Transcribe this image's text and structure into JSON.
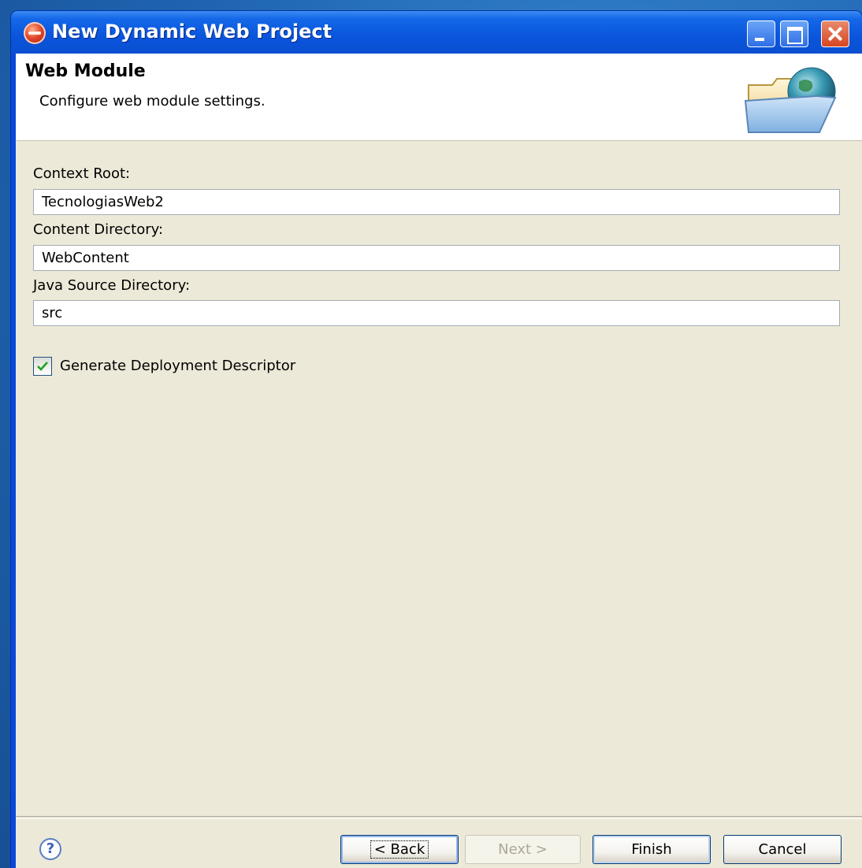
{
  "window": {
    "title": "New Dynamic Web Project"
  },
  "banner": {
    "title": "Web Module",
    "description": "Configure web module settings."
  },
  "fields": [
    {
      "label": "Context Root:",
      "value": "TecnologiasWeb2"
    },
    {
      "label": "Content Directory:",
      "value": "WebContent"
    },
    {
      "label": "Java Source Directory:",
      "value": "src"
    }
  ],
  "options": {
    "generate_dd_label": "Generate Deployment Descriptor",
    "generate_dd_checked": true
  },
  "buttons": {
    "help": "?",
    "back": "< Back",
    "next": "Next >",
    "finish": "Finish",
    "cancel": "Cancel"
  },
  "colors": {
    "titlebar": "#0a55dc",
    "dialog_bg": "#ece9d8",
    "banner_bg": "#ffffff",
    "desktop": "#1f64b0"
  },
  "icons": {
    "app": "eclipse-icon",
    "banner": "folder-globe-icon",
    "help": "help-icon",
    "check": "checkmark-icon"
  }
}
